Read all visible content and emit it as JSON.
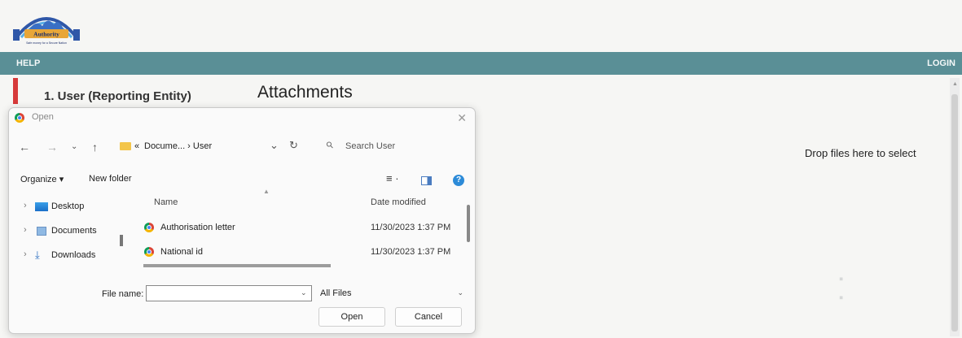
{
  "app": {
    "logo": {
      "text": "Authority",
      "tagline": "Safe money for a Secure Nation",
      "icon": "authority-logo"
    },
    "nav": {
      "help": "HELP",
      "login": "LOGIN"
    },
    "step": {
      "label": "1. User (Reporting Entity)"
    },
    "section_title": "Attachments",
    "dropzone_text": "Drop files here to select",
    "colors": {
      "navbar": "#5a8f96",
      "step_marker": "#d63a3a",
      "page_bg": "#f6f6f4"
    }
  },
  "dialog": {
    "title": "Open",
    "title_icon": "chrome-icon",
    "nav": {
      "back_icon": "back-arrow-icon",
      "forward_icon": "forward-arrow-icon",
      "recent_icon": "chevron-down-icon",
      "up_icon": "up-arrow-icon"
    },
    "path": {
      "prefix": "«",
      "text": "Docume... › User"
    },
    "search": {
      "placeholder": "Search User"
    },
    "toolbar": {
      "organize": "Organize ▾",
      "new_folder": "New folder",
      "help": "?"
    },
    "sidebar": [
      {
        "label": "Desktop",
        "icon": "desktop-folder-icon"
      },
      {
        "label": "Documents",
        "icon": "documents-icon"
      },
      {
        "label": "Downloads",
        "icon": "download-icon"
      }
    ],
    "columns": {
      "name": "Name",
      "date": "Date modified"
    },
    "files": [
      {
        "name": "Authorisation letter",
        "date": "11/30/2023 1:37 PM",
        "icon": "chrome-icon"
      },
      {
        "name": "National id",
        "date": "11/30/2023 1:37 PM",
        "icon": "chrome-icon"
      }
    ],
    "filename": {
      "label": "File name:",
      "value": ""
    },
    "filter": {
      "value": "All Files"
    },
    "buttons": {
      "open": "Open",
      "cancel": "Cancel"
    }
  }
}
